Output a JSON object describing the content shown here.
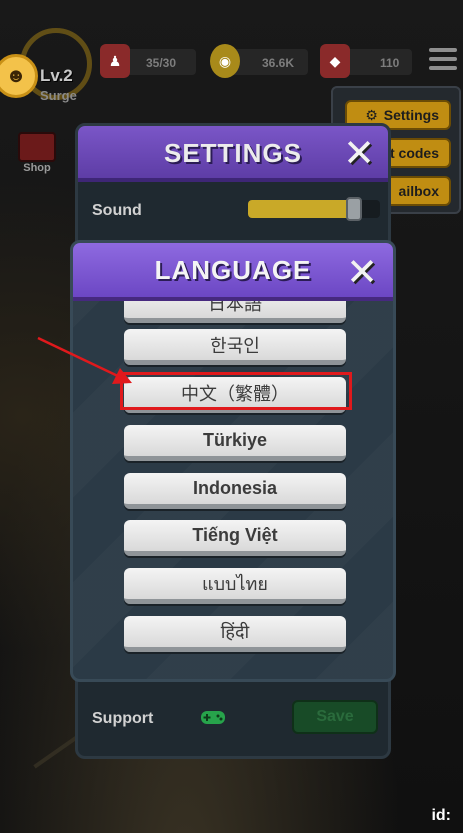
{
  "hud": {
    "level": "Lv.2",
    "rank": "Surge",
    "resources": [
      {
        "icon": "worker-icon",
        "value": "35/30",
        "color": "#8a2a2a"
      },
      {
        "icon": "gold-coin-icon",
        "value": "36.6K",
        "color": "#a88a1a"
      },
      {
        "icon": "gem-icon",
        "value": "110",
        "color": "#8a2a2a"
      }
    ],
    "shop_label": "Shop"
  },
  "side_menu": {
    "items": [
      {
        "label": "Settings",
        "icon": "gear-icon"
      },
      {
        "label": "ft codes"
      },
      {
        "label": "ailbox"
      }
    ]
  },
  "settings": {
    "title": "SETTINGS",
    "sound_label": "Sound",
    "sound_level": 0.8,
    "support_label": "Support",
    "save_label": "Save"
  },
  "language": {
    "title": "LANGUAGE",
    "options": [
      {
        "label": "日本語"
      },
      {
        "label": "한국인"
      },
      {
        "label": "中文（繁體）",
        "selected": true
      },
      {
        "label": "Türkiye"
      },
      {
        "label": "Indonesia"
      },
      {
        "label": "Tiếng Việt"
      },
      {
        "label": "แบบไทย"
      },
      {
        "label": "हिंदी"
      }
    ]
  },
  "footer": {
    "id_label": "id:"
  },
  "colors": {
    "accent_purple": "#7a56c7",
    "highlight_red": "#e0191c",
    "gold": "#c08d12"
  }
}
